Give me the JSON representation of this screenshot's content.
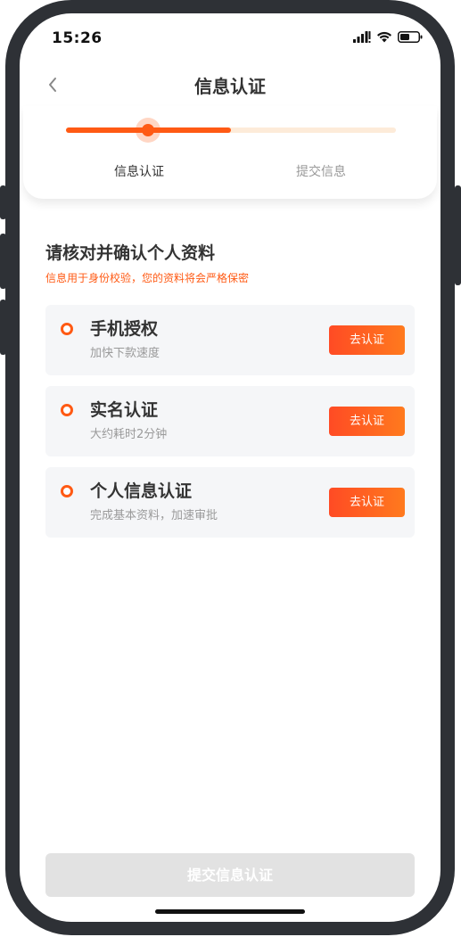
{
  "status_bar": {
    "time": "15:26",
    "icons": [
      "signal-icon",
      "wifi-icon",
      "battery-icon"
    ]
  },
  "nav": {
    "title": "信息认证",
    "back_icon": "chevron-left-icon"
  },
  "steps": {
    "items": [
      {
        "label": "信息认证",
        "active": true
      },
      {
        "label": "提交信息",
        "active": false
      }
    ],
    "progress": 0.5
  },
  "content": {
    "title": "请核对并确认个人资料",
    "subtitle": "信息用于身份校验，您的资料将会严格保密"
  },
  "items": [
    {
      "title": "手机授权",
      "desc": "加快下款速度",
      "button": "去认证"
    },
    {
      "title": "实名认证",
      "desc": "大约耗时2分钟",
      "button": "去认证"
    },
    {
      "title": "个人信息认证",
      "desc": "完成基本资料，加速审批",
      "button": "去认证"
    }
  ],
  "submit": {
    "label": "提交信息认证"
  },
  "colors": {
    "accent": "#ff5a14",
    "accent_light": "#fdebd9",
    "button_gradient_start": "#ff4b24",
    "button_gradient_end": "#ff7a1e",
    "disabled": "#e2e2e2",
    "card_bg": "#f5f6f8"
  }
}
